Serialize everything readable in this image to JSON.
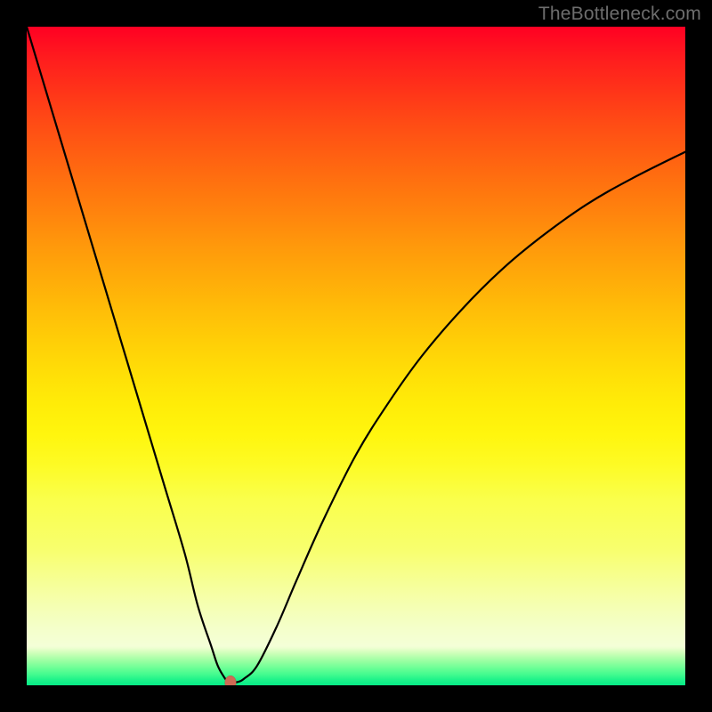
{
  "watermark": "TheBottleneck.com",
  "chart_data": {
    "type": "line",
    "title": "",
    "xlabel": "",
    "ylabel": "",
    "xlim": [
      0,
      100
    ],
    "ylim": [
      0,
      100
    ],
    "grid": false,
    "legend": false,
    "background_gradient": {
      "direction": "vertical",
      "stops": [
        {
          "pos": 0.0,
          "color": "#ff0023"
        },
        {
          "pos": 0.2,
          "color": "#ff5012"
        },
        {
          "pos": 0.4,
          "color": "#ff9a0b"
        },
        {
          "pos": 0.6,
          "color": "#ffde07"
        },
        {
          "pos": 0.78,
          "color": "#f8ff6e"
        },
        {
          "pos": 0.92,
          "color": "#f4ffd0"
        },
        {
          "pos": 1.0,
          "color": "#06eb86"
        }
      ]
    },
    "series": [
      {
        "name": "bottleneck-curve",
        "stroke": "#000000",
        "stroke_width": 2,
        "x": [
          0,
          3,
          6,
          9,
          12,
          15,
          18,
          21,
          24,
          26,
          28,
          29,
          30,
          30.5,
          31,
          32,
          33,
          35,
          38,
          41,
          45,
          50,
          55,
          60,
          66,
          72,
          78,
          85,
          92,
          100
        ],
        "values": [
          100,
          90,
          80,
          70,
          60,
          50,
          40,
          30,
          20,
          12,
          6,
          3,
          1.2,
          0.6,
          0.4,
          0.5,
          1.0,
          3,
          9,
          16,
          25,
          35,
          43,
          50,
          57,
          63,
          68,
          73,
          77,
          81
        ]
      }
    ],
    "marker": {
      "x": 31,
      "y": 0.4,
      "color": "#cf6a55"
    }
  }
}
